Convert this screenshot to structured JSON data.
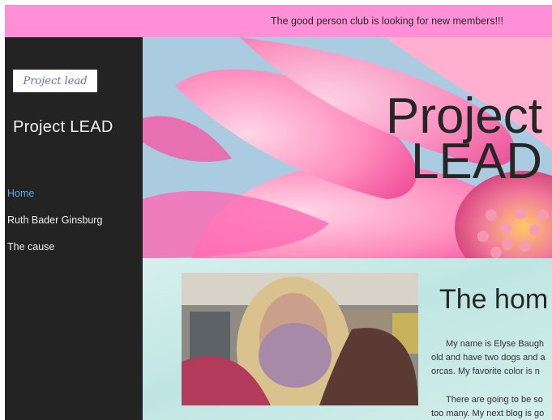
{
  "announcement": "The good person club is looking for new members!!!",
  "sidebar": {
    "logo_text": "Project lead",
    "site_title": "Project LEAD",
    "nav": [
      {
        "label": "Home",
        "active": true
      },
      {
        "label": "Ruth Bader Ginsburg",
        "active": false
      },
      {
        "label": "The cause",
        "active": false
      }
    ]
  },
  "hero": {
    "title_line1": "Project",
    "title_line2": "LEAD"
  },
  "main": {
    "heading": "The hom",
    "paragraph1": [
      "My name is Elyse Baugh",
      "old and have two dogs and a",
      "orcas. My favorite color is n"
    ],
    "paragraph2": [
      "There are going to be so",
      "too many. My next blog is go"
    ]
  },
  "colors": {
    "announcement_bg": "#ff8fd6",
    "sidebar_bg": "#232323",
    "nav_active": "#5aa9e6"
  }
}
